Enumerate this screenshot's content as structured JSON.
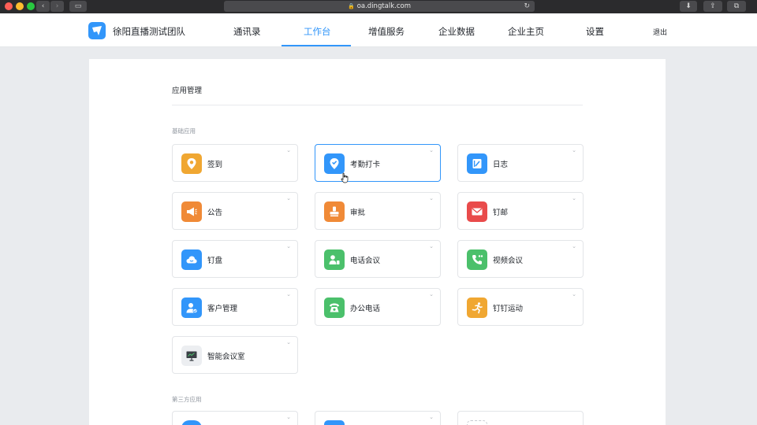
{
  "browser": {
    "url": "oa.dingtalk.com",
    "lock_glyph": "🔒",
    "back_glyph": "‹",
    "forward_glyph": "›",
    "sidebar_glyph": "▭",
    "reload_glyph": "↻",
    "download_glyph": "⬇",
    "share_glyph": "⇪",
    "tabs_glyph": "⧉"
  },
  "header": {
    "team_name": "徐阳直播测试团队",
    "nav": [
      "通讯录",
      "工作台",
      "增值服务",
      "企业数据",
      "企业主页",
      "设置"
    ],
    "active_nav": "工作台",
    "logout": "退出",
    "accent": "#3296fa"
  },
  "main": {
    "section_title": "应用管理",
    "basic_group": "基础应用",
    "third_party_group": "第三方应用",
    "chevron": "⌄",
    "apps": [
      {
        "label": "签到",
        "icon": "location-pin-icon",
        "color": "#f0a732"
      },
      {
        "label": "考勤打卡",
        "icon": "checkin-pin-icon",
        "color": "#3296fa"
      },
      {
        "label": "日志",
        "icon": "notebook-icon",
        "color": "#3296fa"
      },
      {
        "label": "公告",
        "icon": "megaphone-icon",
        "color": "#f08a37"
      },
      {
        "label": "审批",
        "icon": "stamp-icon",
        "color": "#f08a37"
      },
      {
        "label": "钉邮",
        "icon": "mail-icon",
        "color": "#e94b4b"
      },
      {
        "label": "钉盘",
        "icon": "cloud-icon",
        "color": "#3296fa"
      },
      {
        "label": "电话会议",
        "icon": "phone-person-icon",
        "color": "#4bc06b"
      },
      {
        "label": "视频会议",
        "icon": "video-call-icon",
        "color": "#4bc06b"
      },
      {
        "label": "客户管理",
        "icon": "customer-icon",
        "color": "#3296fa"
      },
      {
        "label": "办公电话",
        "icon": "desk-phone-icon",
        "color": "#4bc06b"
      },
      {
        "label": "钉钉运动",
        "icon": "runner-icon",
        "color": "#f0a732"
      },
      {
        "label": "智能会议室",
        "icon": "presentation-board-icon",
        "color": "#eceef1"
      }
    ]
  }
}
